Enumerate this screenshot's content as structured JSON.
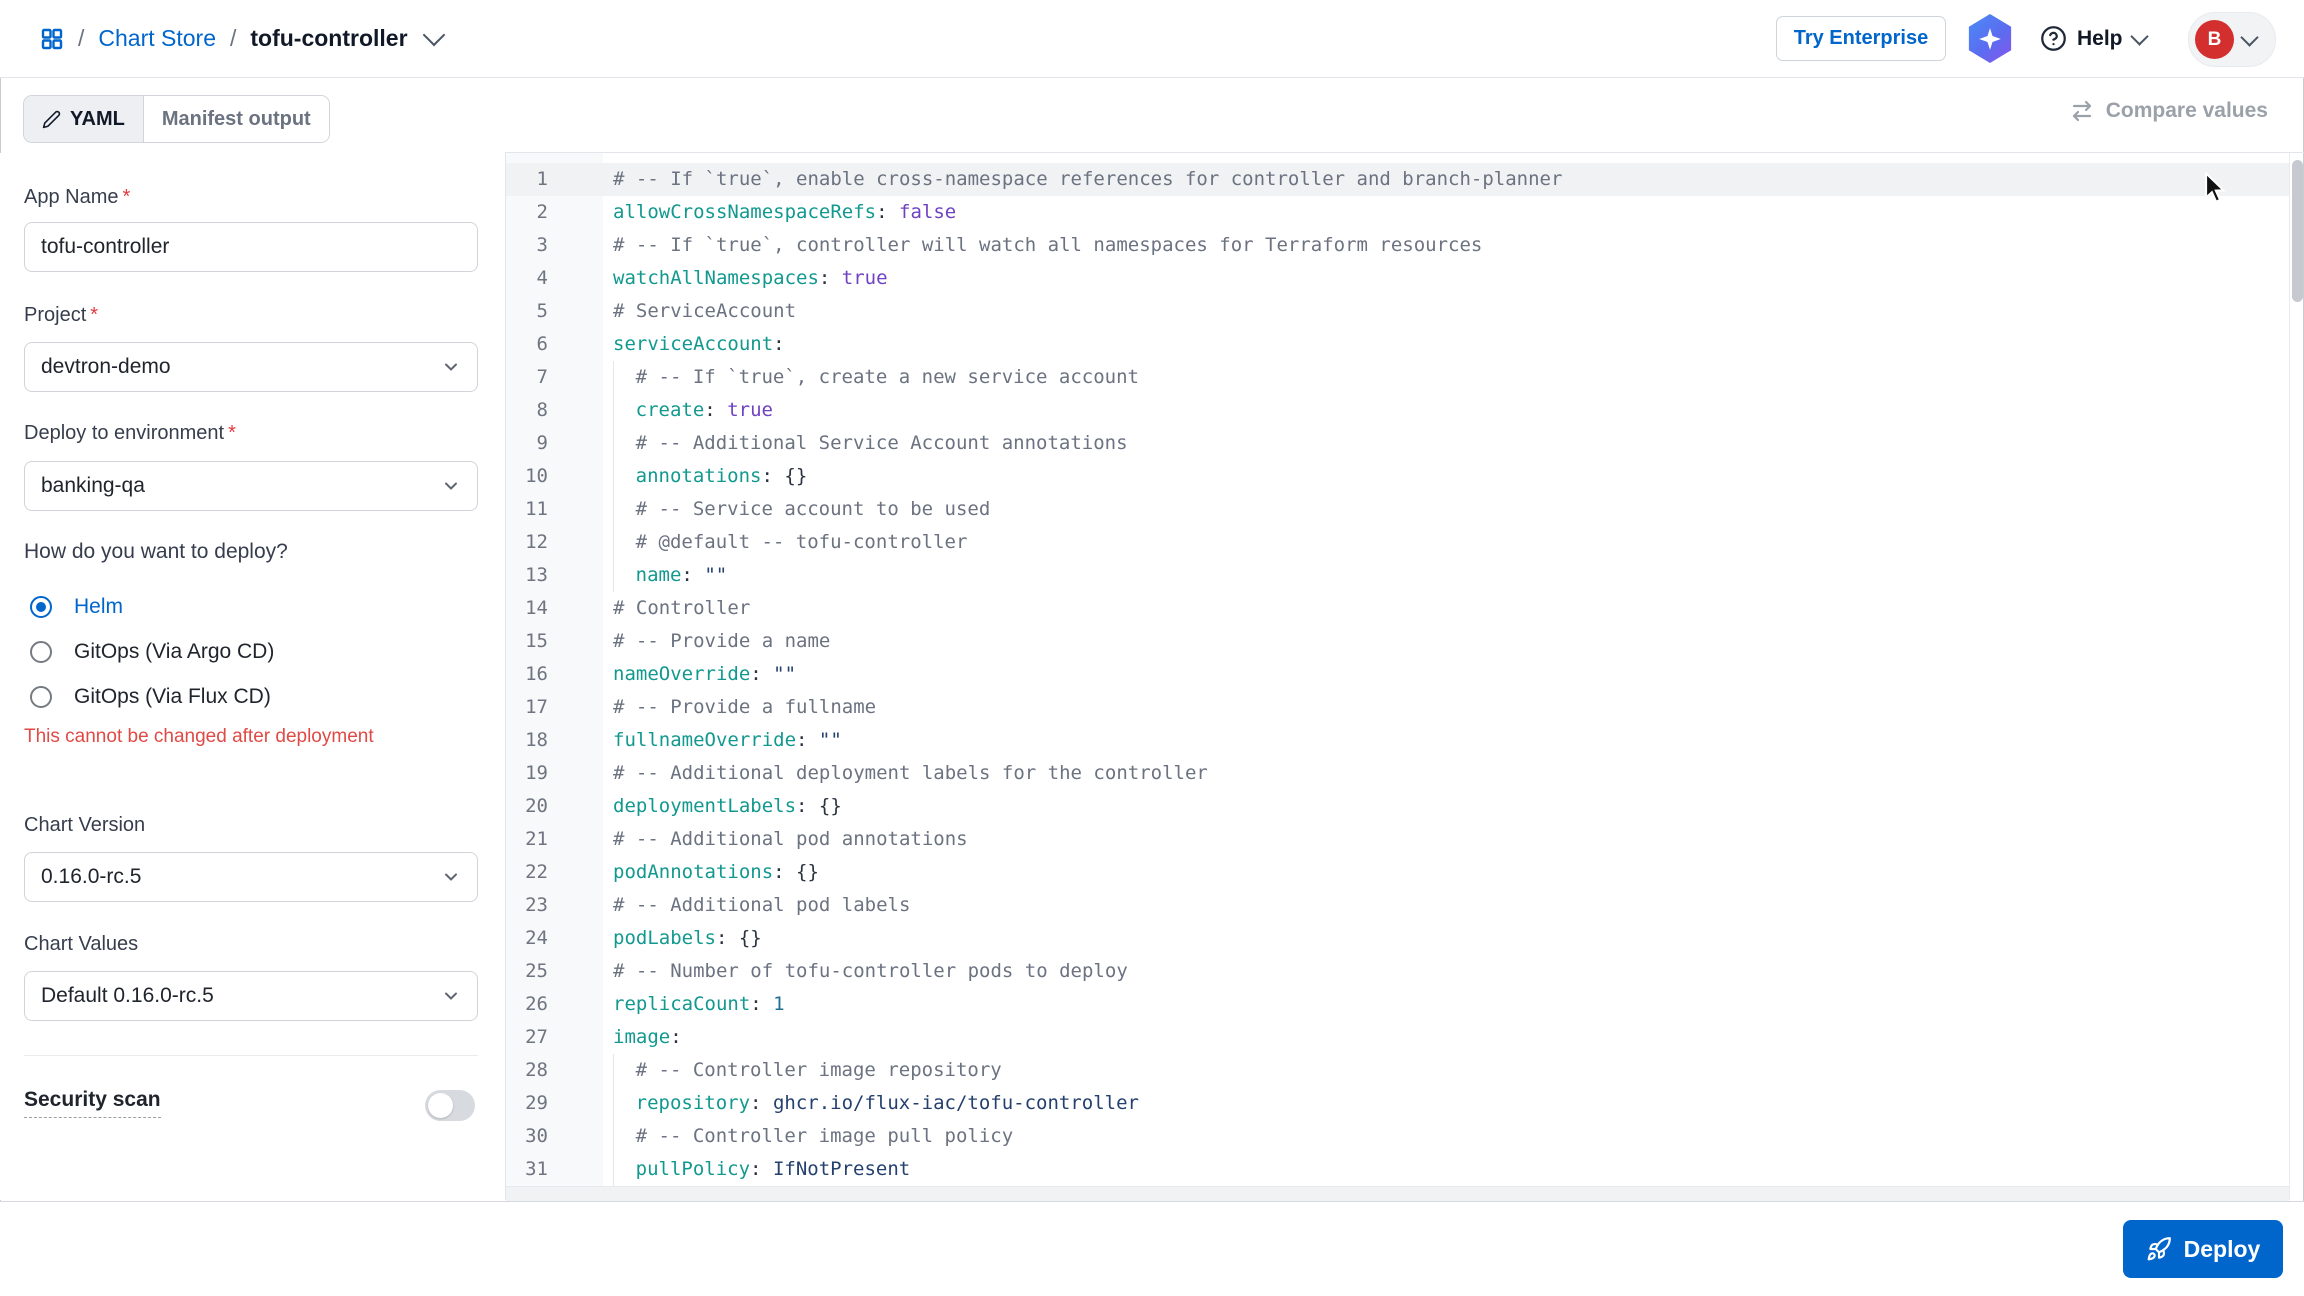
{
  "ui": {
    "required_marker": "*"
  },
  "header": {
    "breadcrumb": {
      "separator": "/",
      "store_label": "Chart Store",
      "app_label": "tofu-controller"
    },
    "try_enterprise": "Try Enterprise",
    "help": "Help",
    "avatar_initial": "B"
  },
  "toolbar": {
    "tabs": [
      {
        "label": "YAML",
        "icon": "pencil-icon",
        "active": true
      },
      {
        "label": "Manifest output",
        "active": false
      }
    ],
    "compare_values": "Compare values"
  },
  "sidebar": {
    "app_name": {
      "label": "App Name",
      "required": true,
      "value": "tofu-controller"
    },
    "project": {
      "label": "Project",
      "required": true,
      "value": "devtron-demo"
    },
    "environment": {
      "label": "Deploy to environment",
      "required": true,
      "value": "banking-qa"
    },
    "deploy_method": {
      "question": "How do you want to deploy?",
      "options": [
        {
          "label": "Helm",
          "selected": true
        },
        {
          "label": "GitOps (Via Argo CD)",
          "selected": false
        },
        {
          "label": "GitOps (Via Flux CD)",
          "selected": false
        }
      ],
      "note": "This cannot be changed after deployment"
    },
    "chart_version": {
      "label": "Chart Version",
      "value": "0.16.0-rc.5"
    },
    "chart_values": {
      "label": "Chart Values",
      "value": "Default 0.16.0-rc.5"
    },
    "security_scan": {
      "label": "Security scan",
      "enabled": false
    }
  },
  "editor": {
    "lines": [
      {
        "n": 1,
        "active": true,
        "tokens": [
          [
            "c",
            "# -- If `true`, enable cross-namespace references for controller and branch-planner"
          ]
        ]
      },
      {
        "n": 2,
        "tokens": [
          [
            "k",
            "allowCrossNamespaceRefs"
          ],
          [
            "p",
            ": "
          ],
          [
            "b",
            "false"
          ]
        ]
      },
      {
        "n": 3,
        "tokens": [
          [
            "c",
            "# -- If `true`, controller will watch all namespaces for Terraform resources"
          ]
        ]
      },
      {
        "n": 4,
        "tokens": [
          [
            "k",
            "watchAllNamespaces"
          ],
          [
            "p",
            ": "
          ],
          [
            "b",
            "true"
          ]
        ]
      },
      {
        "n": 5,
        "tokens": [
          [
            "c",
            "# ServiceAccount"
          ]
        ]
      },
      {
        "n": 6,
        "tokens": [
          [
            "k",
            "serviceAccount"
          ],
          [
            "p",
            ":"
          ]
        ]
      },
      {
        "n": 7,
        "indent": 2,
        "tokens": [
          [
            "c",
            "# -- If `true`, create a new service account"
          ]
        ]
      },
      {
        "n": 8,
        "indent": 2,
        "tokens": [
          [
            "k",
            "create"
          ],
          [
            "p",
            ": "
          ],
          [
            "b",
            "true"
          ]
        ]
      },
      {
        "n": 9,
        "indent": 2,
        "tokens": [
          [
            "c",
            "# -- Additional Service Account annotations"
          ]
        ]
      },
      {
        "n": 10,
        "indent": 2,
        "tokens": [
          [
            "k",
            "annotations"
          ],
          [
            "p",
            ": "
          ],
          [
            "w",
            "{}"
          ]
        ]
      },
      {
        "n": 11,
        "indent": 2,
        "tokens": [
          [
            "c",
            "# -- Service account to be used"
          ]
        ]
      },
      {
        "n": 12,
        "indent": 2,
        "tokens": [
          [
            "c",
            "# @default -- tofu-controller"
          ]
        ]
      },
      {
        "n": 13,
        "indent": 2,
        "tokens": [
          [
            "k",
            "name"
          ],
          [
            "p",
            ": "
          ],
          [
            "s",
            "\"\""
          ]
        ]
      },
      {
        "n": 14,
        "tokens": [
          [
            "c",
            "# Controller"
          ]
        ]
      },
      {
        "n": 15,
        "tokens": [
          [
            "c",
            "# -- Provide a name"
          ]
        ]
      },
      {
        "n": 16,
        "tokens": [
          [
            "k",
            "nameOverride"
          ],
          [
            "p",
            ": "
          ],
          [
            "s",
            "\"\""
          ]
        ]
      },
      {
        "n": 17,
        "tokens": [
          [
            "c",
            "# -- Provide a fullname"
          ]
        ]
      },
      {
        "n": 18,
        "tokens": [
          [
            "k",
            "fullnameOverride"
          ],
          [
            "p",
            ": "
          ],
          [
            "s",
            "\"\""
          ]
        ]
      },
      {
        "n": 19,
        "tokens": [
          [
            "c",
            "# -- Additional deployment labels for the controller"
          ]
        ]
      },
      {
        "n": 20,
        "tokens": [
          [
            "k",
            "deploymentLabels"
          ],
          [
            "p",
            ": "
          ],
          [
            "w",
            "{}"
          ]
        ]
      },
      {
        "n": 21,
        "tokens": [
          [
            "c",
            "# -- Additional pod annotations"
          ]
        ]
      },
      {
        "n": 22,
        "tokens": [
          [
            "k",
            "podAnnotations"
          ],
          [
            "p",
            ": "
          ],
          [
            "w",
            "{}"
          ]
        ]
      },
      {
        "n": 23,
        "tokens": [
          [
            "c",
            "# -- Additional pod labels"
          ]
        ]
      },
      {
        "n": 24,
        "tokens": [
          [
            "k",
            "podLabels"
          ],
          [
            "p",
            ": "
          ],
          [
            "w",
            "{}"
          ]
        ]
      },
      {
        "n": 25,
        "tokens": [
          [
            "c",
            "# -- Number of tofu-controller pods to deploy"
          ]
        ]
      },
      {
        "n": 26,
        "tokens": [
          [
            "k",
            "replicaCount"
          ],
          [
            "p",
            ": "
          ],
          [
            "n",
            "1"
          ]
        ]
      },
      {
        "n": 27,
        "tokens": [
          [
            "k",
            "image"
          ],
          [
            "p",
            ":"
          ]
        ]
      },
      {
        "n": 28,
        "indent": 2,
        "tokens": [
          [
            "c",
            "# -- Controller image repository"
          ]
        ]
      },
      {
        "n": 29,
        "indent": 2,
        "tokens": [
          [
            "k",
            "repository"
          ],
          [
            "p",
            ": "
          ],
          [
            "s",
            "ghcr.io/flux-iac/tofu-controller"
          ]
        ]
      },
      {
        "n": 30,
        "indent": 2,
        "tokens": [
          [
            "c",
            "# -- Controller image pull policy"
          ]
        ]
      },
      {
        "n": 31,
        "indent": 2,
        "tokens": [
          [
            "k",
            "pullPolicy"
          ],
          [
            "p",
            ": "
          ],
          [
            "s",
            "IfNotPresent"
          ]
        ]
      }
    ]
  },
  "footer": {
    "deploy": "Deploy"
  },
  "colors": {
    "accent": "#0066cc",
    "danger": "#e5383e",
    "warning_text": "#df4a45",
    "avatar_red": "#d32f2f",
    "code_key": "#12998f",
    "code_boolean": "#6f42c1",
    "code_string": "#24406e",
    "code_comment": "#6b7280",
    "active_line_bg": "#f0f2f4"
  }
}
